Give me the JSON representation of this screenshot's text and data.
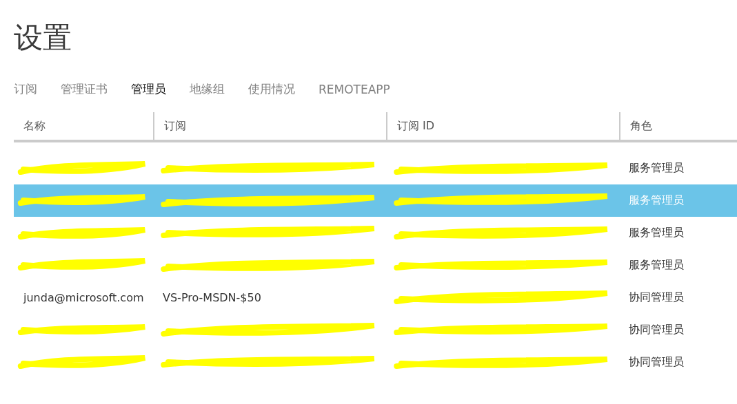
{
  "title": "设置",
  "tabs": [
    {
      "label": "订阅",
      "selected": false
    },
    {
      "label": "管理证书",
      "selected": false
    },
    {
      "label": "管理员",
      "selected": true
    },
    {
      "label": "地缘组",
      "selected": false
    },
    {
      "label": "使用情况",
      "selected": false
    },
    {
      "label": "REMOTEAPP",
      "selected": false
    }
  ],
  "table": {
    "columns": [
      "名称",
      "订阅",
      "订阅 ID",
      "角色"
    ],
    "rows": [
      {
        "selected": false,
        "role": "服务管理员"
      },
      {
        "selected": true,
        "role": "服务管理员"
      },
      {
        "selected": false,
        "role": "服务管理员"
      },
      {
        "selected": false,
        "role": "服务管理员"
      },
      {
        "selected": false,
        "name": "junda@microsoft.com",
        "subscription": "VS-Pro-MSDN-$50",
        "role": "协同管理员"
      },
      {
        "selected": false,
        "role": "协同管理员"
      },
      {
        "selected": false,
        "role": "协同管理员"
      }
    ]
  }
}
